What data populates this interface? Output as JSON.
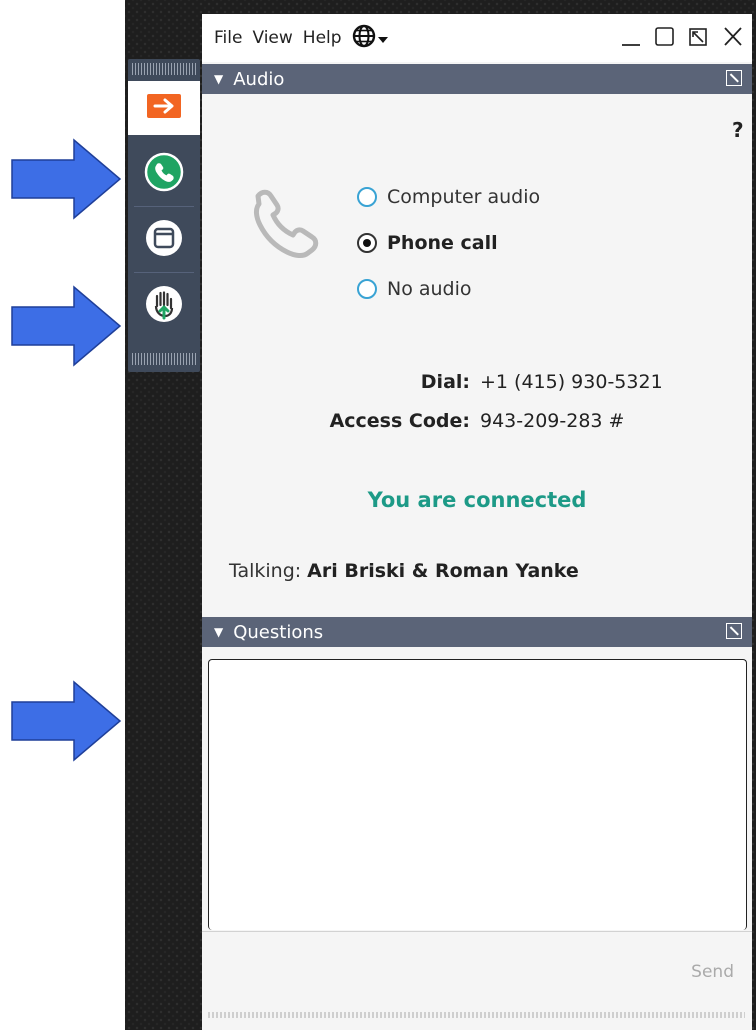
{
  "menubar": {
    "file": "File",
    "view": "View",
    "help": "Help"
  },
  "audio": {
    "title": "Audio",
    "help": "?",
    "options": [
      {
        "label": "Computer audio",
        "checked": false
      },
      {
        "label": "Phone call",
        "checked": true
      },
      {
        "label": "No audio",
        "checked": false
      }
    ],
    "dial_label": "Dial:",
    "dial_value": "+1 (415) 930-5321",
    "access_label": "Access Code:",
    "access_value": "943-209-283 #",
    "status": "You are connected",
    "talking_label": "Talking:",
    "talking_names": "Ari Briski & Roman Yanke"
  },
  "questions": {
    "title": "Questions",
    "send_label": "Send"
  },
  "colors": {
    "accent_green": "#1d9a87",
    "section_bar": "#5b6478",
    "toolbar": "#3f4a5b",
    "arrow_blue": "#3d6ee6",
    "orange": "#f26522"
  },
  "icons": [
    "arrow-right-icon",
    "phone-icon",
    "window-icon",
    "raise-hand-icon",
    "globe-icon",
    "minimize-icon",
    "maximize-icon",
    "popout-icon",
    "close-icon",
    "handset-icon"
  ]
}
